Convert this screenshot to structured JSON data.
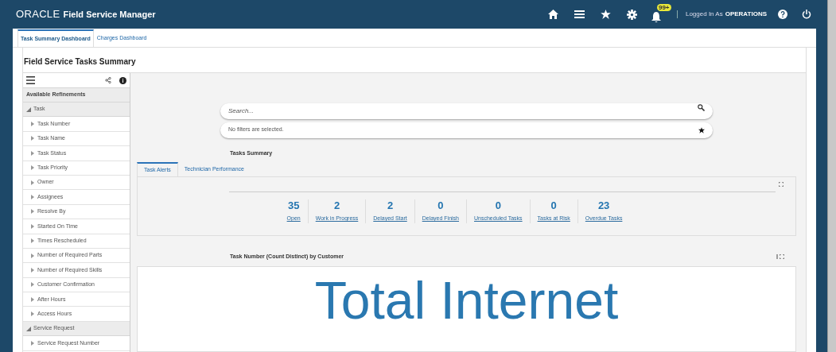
{
  "header": {
    "logo": "ORACLE",
    "app_title": "Field Service Manager",
    "notification_badge": "99+",
    "logged_in_label": "Logged In As",
    "user": "OPERATIONS"
  },
  "tabs": [
    {
      "label": "Task Summary Dashboard",
      "selected": true
    },
    {
      "label": "Charges Dashboard",
      "selected": false
    }
  ],
  "page_title": "Field Service Tasks Summary",
  "sidebar": {
    "heading": "Available Refinements",
    "groups": [
      {
        "label": "Task",
        "expanded": true,
        "children": [
          {
            "label": "Task Number"
          },
          {
            "label": "Task Name"
          },
          {
            "label": "Task Status"
          },
          {
            "label": "Task Priority"
          },
          {
            "label": "Owner"
          },
          {
            "label": "Assignees"
          },
          {
            "label": "Resolve By"
          },
          {
            "label": "Started On Time"
          },
          {
            "label": "Times Rescheduled"
          },
          {
            "label": "Number of Required Parts"
          },
          {
            "label": "Number of Required Skills"
          },
          {
            "label": "Customer Confirmation"
          },
          {
            "label": "After Hours"
          },
          {
            "label": "Access Hours"
          }
        ]
      },
      {
        "label": "Service Request",
        "expanded": true,
        "children": [
          {
            "label": "Service Request Number"
          }
        ]
      }
    ]
  },
  "search": {
    "placeholder": "Search...",
    "filters_text": "No filters are selected."
  },
  "summary_title": "Tasks Summary",
  "summary_tabs": [
    {
      "label": "Task Alerts",
      "selected": true
    },
    {
      "label": "Technician Performance",
      "selected": false
    }
  ],
  "metrics": [
    {
      "value": "35",
      "label": "Open"
    },
    {
      "value": "2",
      "label": "Work in Progress"
    },
    {
      "value": "2",
      "label": "Delayed Start"
    },
    {
      "value": "0",
      "label": "Delayed Finish"
    },
    {
      "value": "0",
      "label": "Unscheduled Tasks"
    },
    {
      "value": "0",
      "label": "Tasks at Risk"
    },
    {
      "value": "23",
      "label": "Overdue Tasks"
    }
  ],
  "chart_panel": {
    "title": "Task Number (Count Distinct) by Customer",
    "word": "Total Internet"
  }
}
